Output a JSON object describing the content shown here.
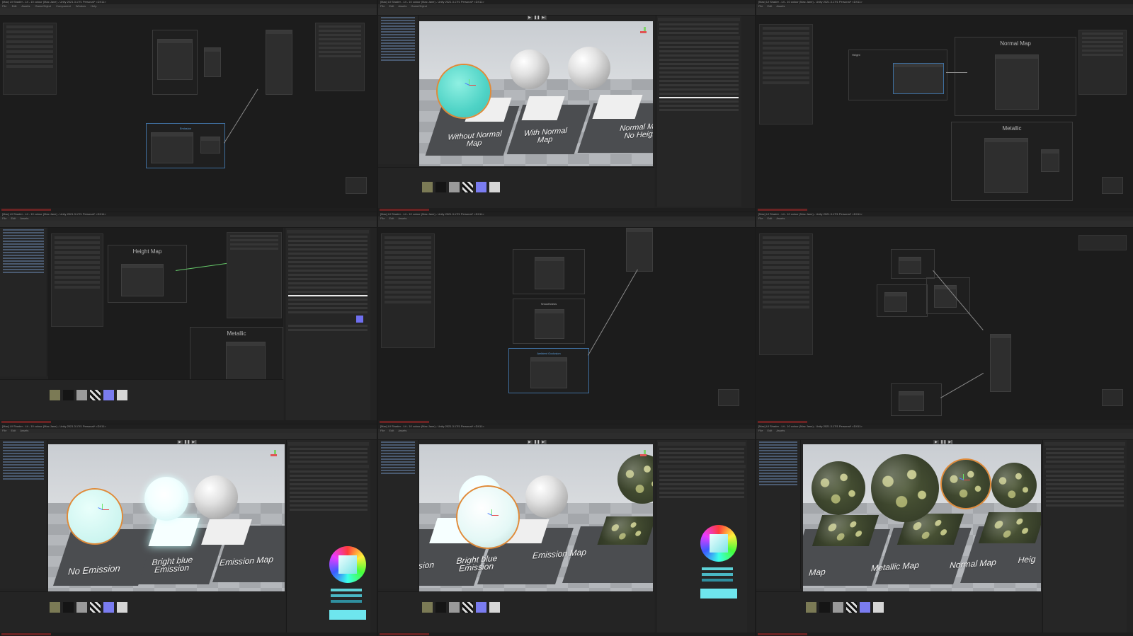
{
  "window": {
    "title": "[Mac] UI Shader - Lit - 10 colour (Mac Jane) - Unity 2021.3.17f1 Personal* <DX11>",
    "menu": [
      "File",
      "Edit",
      "Assets",
      "GameObject",
      "Component",
      "Window",
      "Help"
    ]
  },
  "graph_labels": {
    "emission": "Emission",
    "normal_map": "Normal Map",
    "metallic": "Metallic",
    "height_map": "Height Map",
    "ambient_occlusion": "Ambient Occlusion",
    "smoothness": "Smoothness",
    "albedo": "Albedo",
    "height": "Height"
  },
  "scene_labels": {
    "without_normal_map": "Without Normal Map",
    "with_normal_map": "With Normal Map",
    "normal_map_no_height": "Normal Map No Heigh",
    "no_emission": "No Emission",
    "bright_blue_emission": "Bright blue Emission",
    "emission_map": "Emission Map",
    "bright_blue_emission_cropped": "Bright blue Emission",
    "emission_map_2": "Emission Map",
    "sion": "sion",
    "map": "Map",
    "metallic_map": "Metallic Map",
    "normal_map": "Normal Map",
    "heig": "Heig"
  },
  "colors": {
    "accent_selection": "#3f6f9f",
    "teal": "#4fd3c6",
    "outline": "#e08a38",
    "wire_green": "#66c96a"
  },
  "icons": [
    "play-icon",
    "pause-icon",
    "step-icon",
    "gizmo-icon",
    "color-wheel-icon"
  ]
}
